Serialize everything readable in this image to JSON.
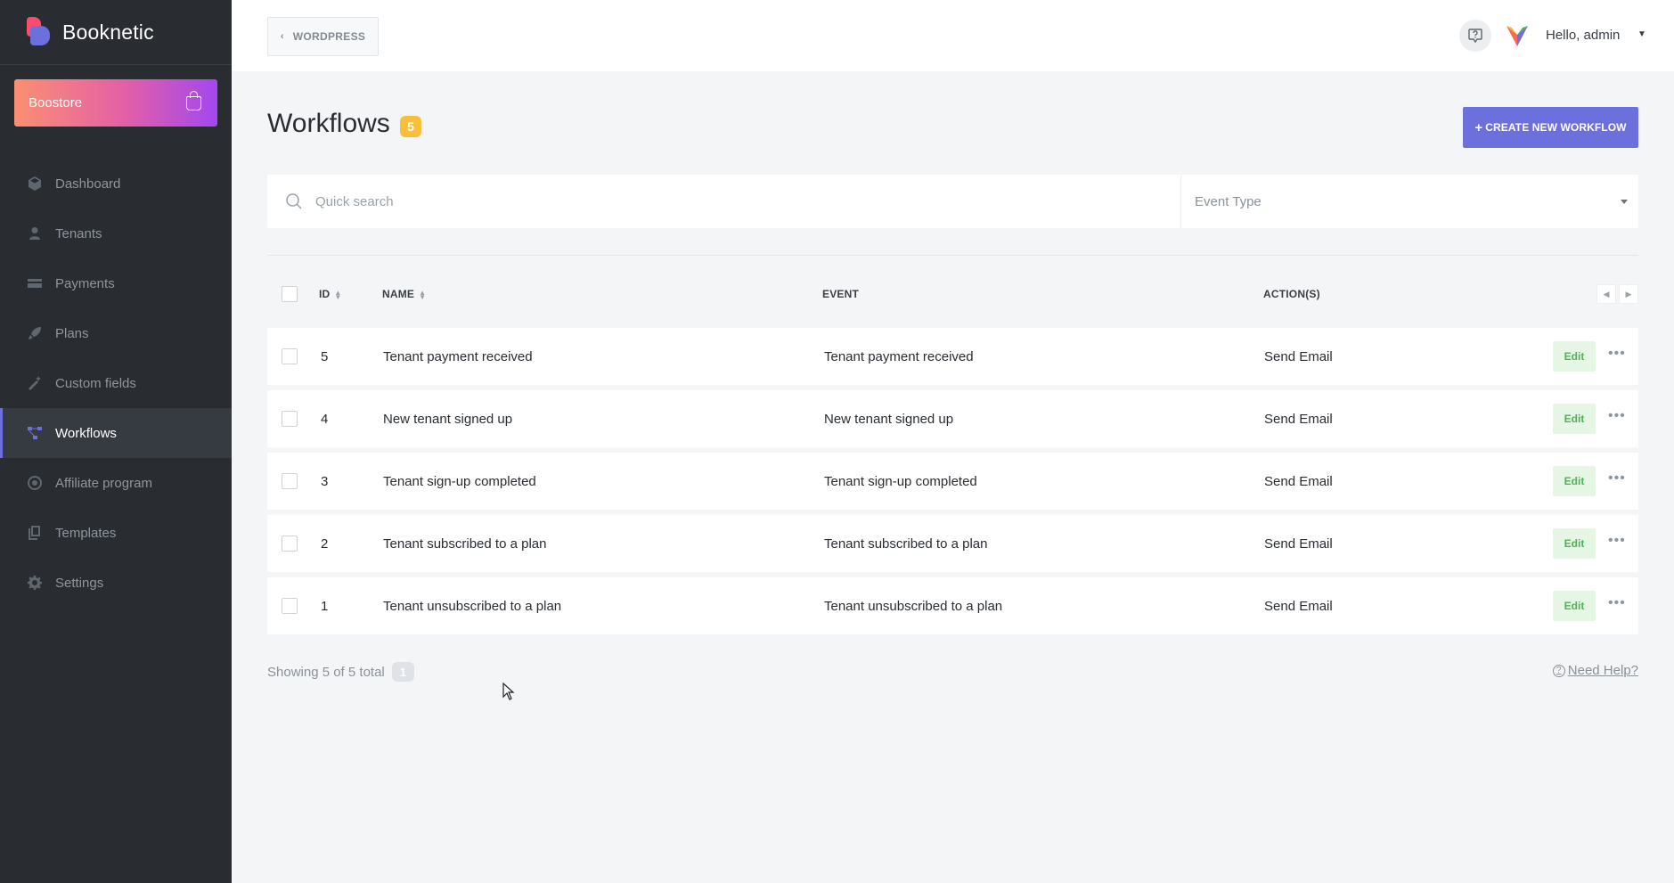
{
  "app": {
    "name": "Booknetic"
  },
  "boostore": {
    "label": "Boostore"
  },
  "sidebar": {
    "items": [
      {
        "label": "Dashboard",
        "icon": "cube-icon",
        "active": false
      },
      {
        "label": "Tenants",
        "icon": "user-icon",
        "active": false
      },
      {
        "label": "Payments",
        "icon": "credit-card-icon",
        "active": false
      },
      {
        "label": "Plans",
        "icon": "rocket-icon",
        "active": false
      },
      {
        "label": "Custom fields",
        "icon": "magic-wand-icon",
        "active": false
      },
      {
        "label": "Workflows",
        "icon": "workflow-icon",
        "active": true
      },
      {
        "label": "Affiliate program",
        "icon": "target-icon",
        "active": false
      },
      {
        "label": "Templates",
        "icon": "copy-icon",
        "active": false
      },
      {
        "label": "Settings",
        "icon": "gear-icon",
        "active": false
      }
    ]
  },
  "header": {
    "back_label": "WORDPRESS",
    "greeting": "Hello, admin"
  },
  "page": {
    "title": "Workflows",
    "count": "5",
    "create_label": "CREATE NEW WORKFLOW"
  },
  "filters": {
    "search_placeholder": "Quick search",
    "event_type_placeholder": "Event Type"
  },
  "table": {
    "columns": {
      "id": "ID",
      "name": "NAME",
      "event": "EVENT",
      "actions": "ACTION(S)"
    },
    "edit_label": "Edit",
    "rows": [
      {
        "id": "5",
        "name": "Tenant payment received",
        "event": "Tenant payment received",
        "action": "Send Email"
      },
      {
        "id": "4",
        "name": "New tenant signed up",
        "event": "New tenant signed up",
        "action": "Send Email"
      },
      {
        "id": "3",
        "name": "Tenant sign-up completed",
        "event": "Tenant sign-up completed",
        "action": "Send Email"
      },
      {
        "id": "2",
        "name": "Tenant subscribed to a plan",
        "event": "Tenant subscribed to a plan",
        "action": "Send Email"
      },
      {
        "id": "1",
        "name": "Tenant unsubscribed to a plan",
        "event": "Tenant unsubscribed to a plan",
        "action": "Send Email"
      }
    ]
  },
  "footer": {
    "showing": "Showing 5 of 5 total",
    "page": "1",
    "help_label": "Need Help?"
  },
  "colors": {
    "accent": "#6c70dc",
    "sidebar_bg": "#292d32",
    "badge": "#f9bf3b",
    "edit_bg": "#e5f6e5",
    "edit_text": "#53b058"
  }
}
